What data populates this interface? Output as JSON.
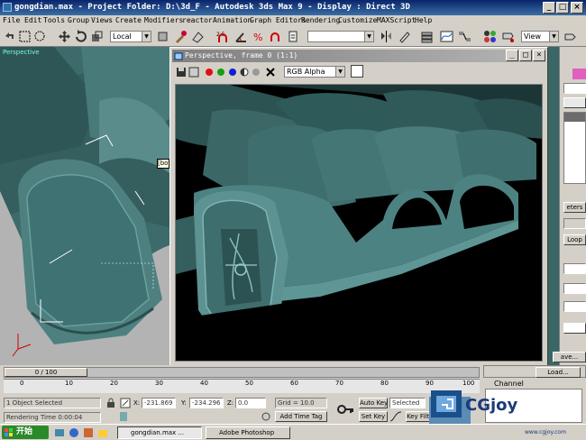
{
  "window": {
    "title": "gongdian.max    - Project Folder: D:\\3d_F     - Autodesk 3ds Max 9     - Display : Direct 3D"
  },
  "menu": [
    "File",
    "Edit",
    "Tools",
    "Group",
    "Views",
    "Create",
    "Modifiers",
    "reactor",
    "Animation",
    "Graph Editors",
    "Rendering",
    "Customize",
    "MAXScript",
    "Help"
  ],
  "toolbar": {
    "coord_system": "Local",
    "view_dropdown": "View"
  },
  "viewport_left": {
    "label": "Perspective",
    "tooltip": "[bot"
  },
  "render_window": {
    "title": "Perspective, frame 0 (1:1)",
    "channel_dropdown": "RGB Alpha"
  },
  "command_panel": {
    "items": [
      "eters",
      "Loop",
      "ave..."
    ]
  },
  "timeline": {
    "frame_counter": "0 / 100",
    "ticks": [
      "0",
      "10",
      "20",
      "30",
      "40",
      "50",
      "60",
      "70",
      "80",
      "90",
      "100"
    ]
  },
  "status": {
    "selection": "1 Object Selected",
    "prompt": "Rendering Time  0:00:04",
    "x_label": "X:",
    "x_value": "-231.869",
    "y_label": "Y:",
    "y_value": "-234.296",
    "z_label": "Z:",
    "z_value": "0.0",
    "grid": "Grid = 10.0",
    "add_time_tag": "Add Time Tag",
    "auto_key": "Auto Key",
    "set_key": "Set Key",
    "key_mode": "Selected",
    "key_filters": "Key Filters..."
  },
  "channel_panel": {
    "label": "Channel",
    "load_button": "Load..."
  },
  "taskbar": {
    "start": "开始",
    "tasks": [
      "gongdian.max ...",
      "Adobe Photoshop"
    ],
    "watermark": "CGjoy",
    "watermark_sub": "www.cgjoy.com"
  }
}
